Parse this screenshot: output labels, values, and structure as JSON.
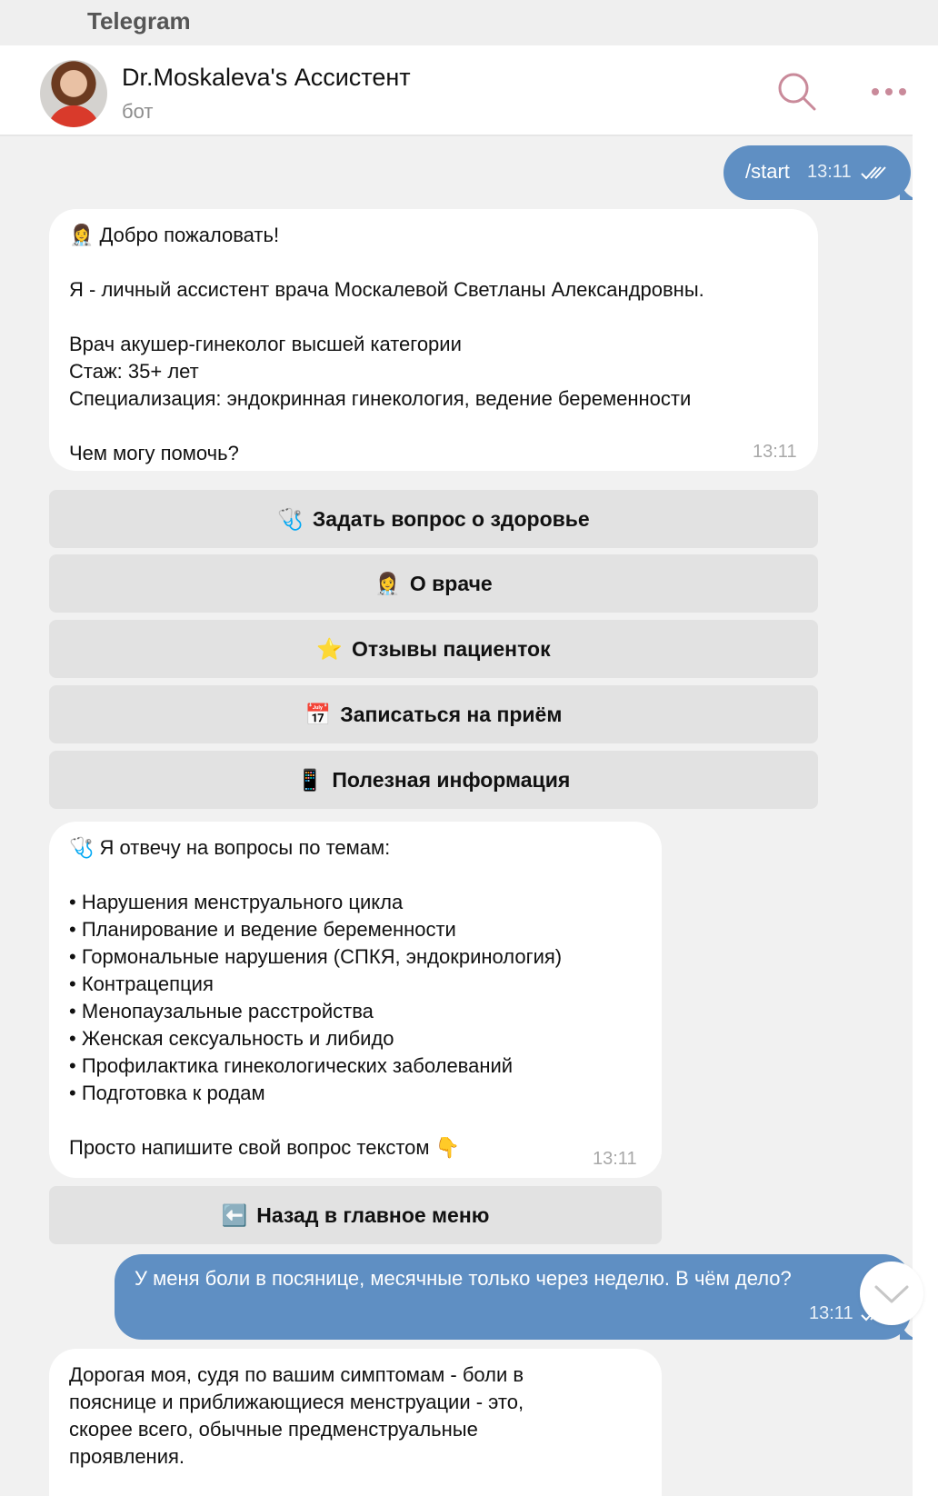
{
  "app": {
    "title": "Telegram"
  },
  "header": {
    "chat_title": "Dr.Moskaleva's Ассистент",
    "chat_subtitle": "бот"
  },
  "messages": {
    "m1": {
      "text": "/start",
      "time": "13:11"
    },
    "m2": {
      "lines": [
        "👩‍⚕️ Добро пожаловать!",
        "Я - личный ассистент врача Москалевой Светланы Александровны.",
        "Врач акушер-гинеколог высшей категории",
        "Стаж: 35+ лет",
        "Специализация: эндокринная гинекология, ведение беременности",
        "Чем могу помочь?"
      ],
      "time": "13:11"
    },
    "keyboard1": [
      {
        "icon": "🩺",
        "label": "Задать вопрос о здоровье"
      },
      {
        "icon": "👩‍⚕️",
        "label": "О враче"
      },
      {
        "icon": "⭐",
        "label": "Отзывы пациенток"
      },
      {
        "icon": "📅",
        "label": "Записаться на приём"
      },
      {
        "icon": "📱",
        "label": "Полезная информация"
      }
    ],
    "m3": {
      "intro": "🩺 Я отвечу на вопросы по темам:",
      "bullets": [
        "• Нарушения менструального цикла",
        "• Планирование и ведение беременности",
        "• Гормональные нарушения (СПКЯ, эндокринология)",
        "• Контрацепция",
        "• Менопаузальные расстройства",
        "• Женская сексуальность и либидо",
        "• Профилактика гинекологических заболеваний",
        "• Подготовка к родам"
      ],
      "outro": "Просто напишите свой вопрос текстом 👇",
      "time": "13:11"
    },
    "keyboard2": [
      {
        "icon": "⬅️",
        "label": "Назад в главное меню"
      }
    ],
    "m4": {
      "text": "У меня боли в посянице, месячные только через неделю. В чём дело?",
      "time": "13:11"
    },
    "m5": {
      "lines": [
        "Дорогая моя, судя по вашим симптомам - боли в",
        "пояснице и приближающиеся менструации - это,",
        "скорее всего, обычные предменструальные",
        "проявления."
      ]
    }
  },
  "colors": {
    "outgoing": "#5f8fc3",
    "icon_accent": "#c98a9a"
  }
}
